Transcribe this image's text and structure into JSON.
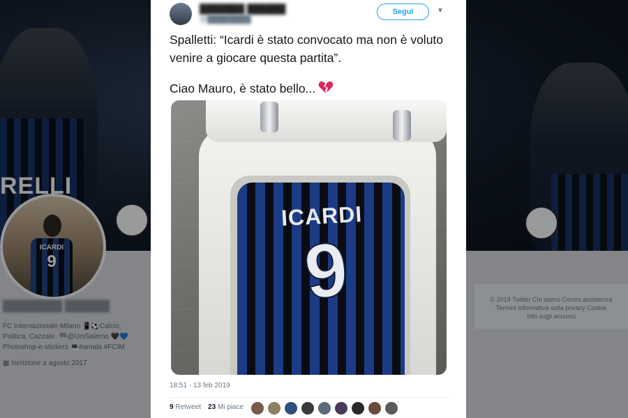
{
  "tweet": {
    "follow_label": "Segui",
    "text_line1": "Spalletti: “Icardi è stato convocato ma non è voluto venire a giocare questa partita”.",
    "text_line2": "Ciao Mauro, è stato bello...",
    "timestamp": "18:51 - 13 feb 2019",
    "retweets_count": "9",
    "retweets_label": "Retweet",
    "likes_count": "23",
    "likes_label": "Mi piace",
    "image_jersey_name": "ICARDI",
    "image_jersey_number": "9",
    "liker_colors": [
      "#7a5a4a",
      "#8f7f60",
      "#2f4f7f",
      "#3c3c3c",
      "#5a6a7a",
      "#4a3a5a",
      "#2a2a2a",
      "#6a4a3a",
      "#5a5a5a"
    ]
  },
  "profile": {
    "bio_line1": "FC Internazionale Milano 📱⚽Calcio,",
    "bio_line2": "Politica, Cazzate. 🏁@UniSalerno 🖤💙",
    "bio_line3": "Photoshop-e-stickers 💻#amala #FCIM",
    "joined": "Iscrizione a agosto 2017",
    "avatar_jersey_name": "ICARDI",
    "avatar_jersey_number": "9"
  },
  "banner": {
    "sponsor_text": "RELLI"
  },
  "footer": {
    "line1": "© 2019 Twitter   Chi siamo   Centro assistenza",
    "line2": "Termini   Informativa sulla privacy   Cookie",
    "line3": "Info sugli annunci"
  },
  "colors": {
    "accent": "#1da1f2",
    "heart": "#e0245e"
  }
}
